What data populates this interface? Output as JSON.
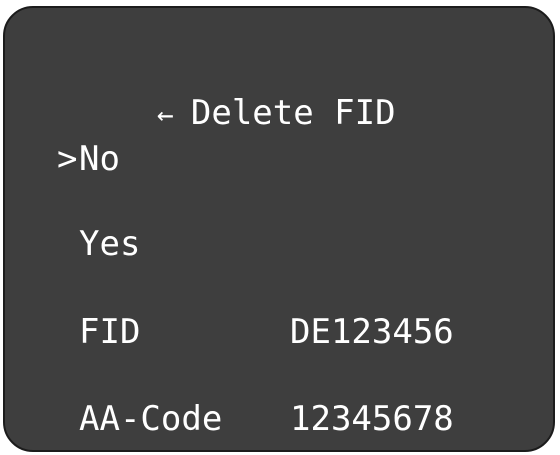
{
  "menu": {
    "back_icon": "←",
    "title": "Delete FID",
    "cursor": ">",
    "options": [
      {
        "label": "No",
        "selected": true
      },
      {
        "label": "Yes",
        "selected": false
      }
    ]
  },
  "info": {
    "fid_label": "FID",
    "fid_value": "DE123456",
    "aa_label": "AA-Code",
    "aa_value": "12345678"
  },
  "colors": {
    "screen_background": "#3e3e3e",
    "text": "#ffffff"
  }
}
